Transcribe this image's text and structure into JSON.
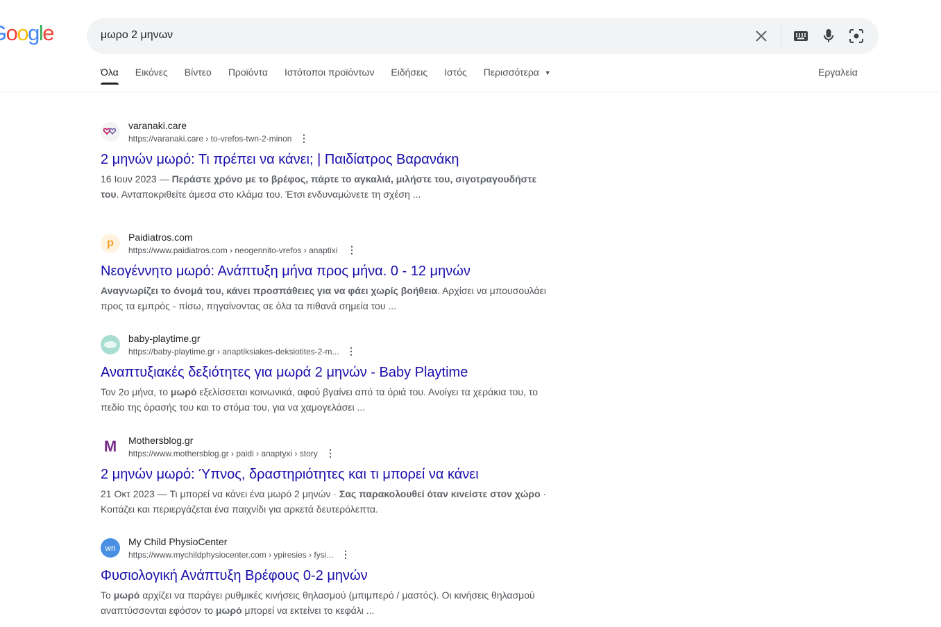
{
  "logo": {
    "letters": [
      "o",
      "o",
      "g",
      "l",
      "e"
    ],
    "prefix": "G"
  },
  "search": {
    "query": "μωρο 2 μηνων",
    "icons": [
      "close-icon",
      "keyboard-icon",
      "mic-icon",
      "lens-icon"
    ]
  },
  "tabs": [
    {
      "label": "Όλα",
      "active": true
    },
    {
      "label": "Εικόνες"
    },
    {
      "label": "Βίντεο"
    },
    {
      "label": "Προϊόντα"
    },
    {
      "label": "Ιστότοποι προϊόντων"
    },
    {
      "label": "Ειδήσεις"
    },
    {
      "label": "Ιστός"
    },
    {
      "label": "Περισσότερα"
    }
  ],
  "tools_label": "Εργαλεία",
  "results": [
    {
      "site": "varanaki.care",
      "url": "https://varanaki.care › to-vrefos-twn-2-minon",
      "title": "2 μηνών μωρό: Τι πρέπει να κάνει; | Παιδίατρος Βαρανάκη",
      "date": "16 Ιουν 2023 — ",
      "bold1": "Περάστε χρόνο με το βρέφος, πάρτε το αγκαλιά, μιλήστε του, σιγοτραγουδήστε του",
      "text1": ". Ανταποκριθείτε άμεσα στο κλάμα του. Έτσι ενδυναμώνετε τη σχέση ..."
    },
    {
      "site": "Paidiatros.com",
      "url": "https://www.paidiatros.com › neogennito-vrefos › anaptixi",
      "title": "Νεογέννητο μωρό: Ανάπτυξη μήνα προς μήνα. 0 - 12 μηνών",
      "bold1": "Αναγνωρίζει το όνομά του, κάνει προσπάθειες για να φάει χωρίς βοήθεια",
      "text1": ". Αρχίσει να μπουσουλάει προς τα εμπρός - πίσω, πηγαίνοντας σε όλα τα πιθανά σημεία του ..."
    },
    {
      "site": "baby-playtime.gr",
      "url": "https://baby-playtime.gr › anaptiksiakes-deksiotites-2-m...",
      "title": "Αναπτυξιακές δεξιότητες για μωρά 2 μηνών - Baby Playtime",
      "text0": "Τον 2ο μήνα, το ",
      "bold1": "μωρό",
      "text1": " εξελίσσεται κοινωνικά, αφού βγαίνει από τα όριά του. Ανοίγει τα χεράκια του, το πεδίο της όρασής του και το στόμα του, για να χαμογελάσει ..."
    },
    {
      "site": "Mothersblog.gr",
      "url": "https://www.mothersblog.gr › paidi › anaptyxi › story",
      "title": "2 μηνών μωρό: Ύπνος, δραστηριότητες και τι μπορεί να κάνει",
      "date": "21 Οκτ 2023 — ",
      "text0": "Τι μπορεί να κάνει ένα μωρό 2 μηνών · ",
      "bold1": "Σας παρακολουθεί όταν κινείστε στον χώρο",
      "text1": " · Κοιτάζει και περιεργάζεται ένα παιχνίδι για αρκετά δευτερόλεπτα."
    },
    {
      "site": "My Child PhysioCenter",
      "url": "https://www.mychildphysiocenter.com › ypiresies › fysi...",
      "title": "Φυσιολογική Ανάπτυξη Βρέφους 0-2 μηνών",
      "text0": "Το ",
      "bold1": "μωρό",
      "text1": " αρχίζει να παράγει ρυθμικές κινήσεις θηλασμού (μπιμπερό / μαστός). Οι κινήσεις θηλασμού αναπτύσσονται εφόσον το ",
      "bold2": "μωρό",
      "text2": " μπορεί να εκτείνει το κεφάλι ..."
    }
  ]
}
